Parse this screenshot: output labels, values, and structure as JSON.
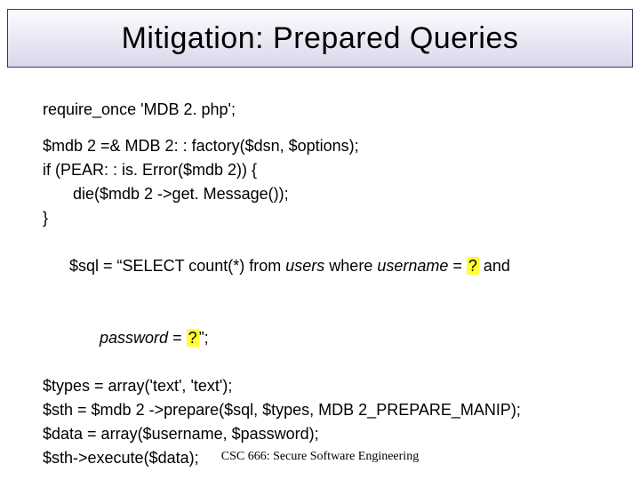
{
  "title": "Mitigation: Prepared Queries",
  "code": {
    "l1": "require_once 'MDB 2. php';",
    "l2": "$mdb 2 =& MDB 2: : factory($dsn, $options);",
    "l3": "if (PEAR: : is. Error($mdb 2)) {",
    "l4": "die($mdb 2 ->get. Message());",
    "l5": "}",
    "sql_a": "$sql = “SELECT count(*) from ",
    "sql_users": "users",
    "sql_b": " where ",
    "sql_username": "username",
    "sql_c": " = ",
    "sql_q1": "?",
    "sql_d": " and",
    "sql_password": "password",
    "sql_e": " = ",
    "sql_q2": "?",
    "sql_f": "”;",
    "l8": "$types = array('text', 'text');",
    "l9": "$sth = $mdb 2 ->prepare($sql, $types, MDB 2_PREPARE_MANIP);",
    "l10": "$data = array($username, $password);",
    "l11": "$sth->execute($data);"
  },
  "footer": "CSC 666: Secure Software Engineering"
}
